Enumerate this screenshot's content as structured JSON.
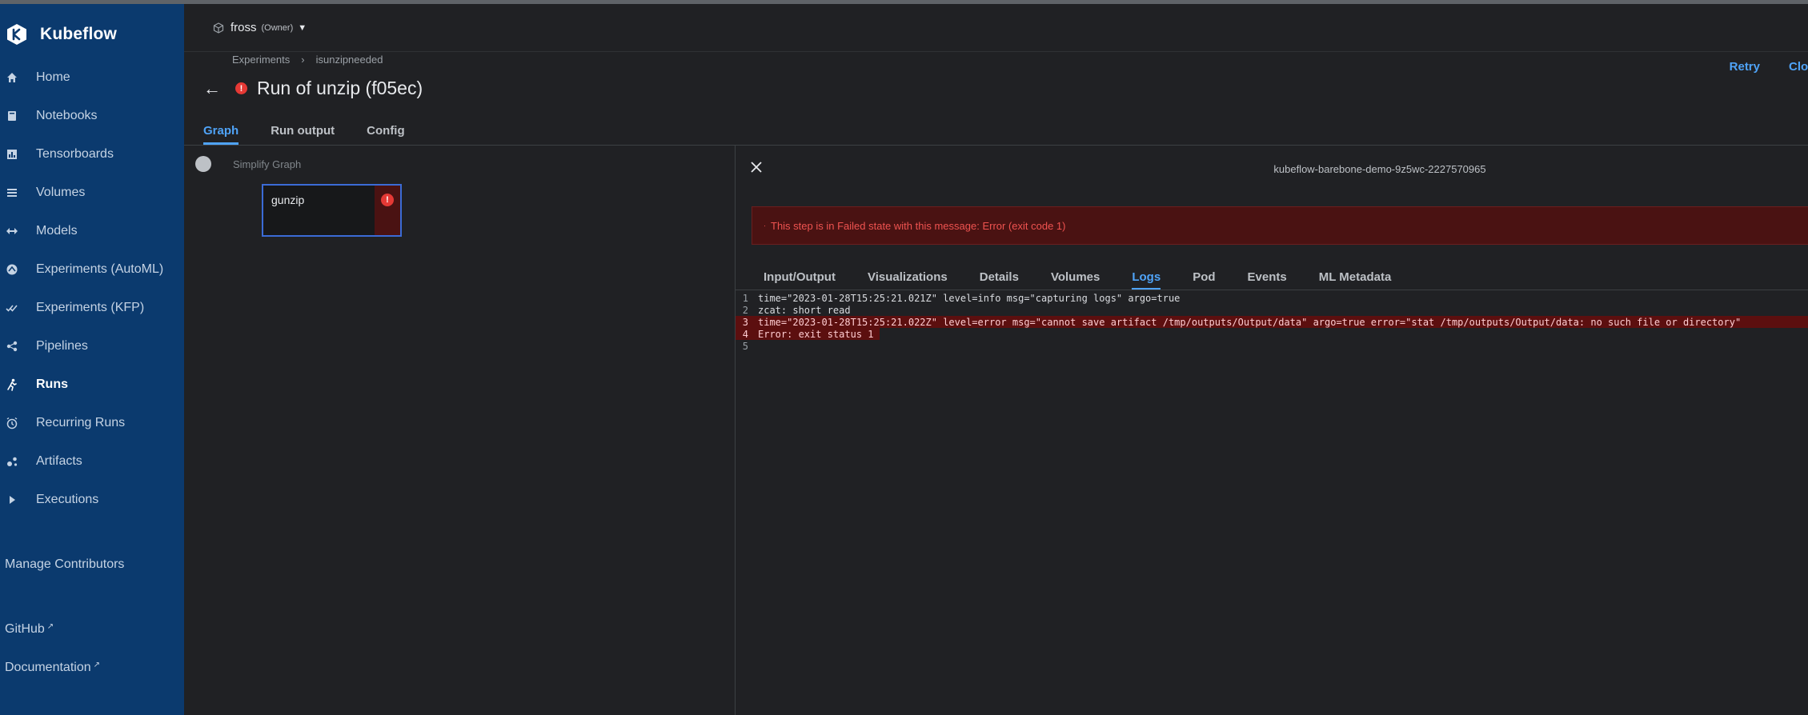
{
  "app": {
    "name": "Kubeflow"
  },
  "sidebar": {
    "items": [
      {
        "label": "Home",
        "icon": "home-icon"
      },
      {
        "label": "Notebooks",
        "icon": "notebook-icon"
      },
      {
        "label": "Tensorboards",
        "icon": "chart-icon"
      },
      {
        "label": "Volumes",
        "icon": "volumes-icon"
      },
      {
        "label": "Models",
        "icon": "arrows-horizontal-icon"
      },
      {
        "label": "Experiments (AutoML)",
        "icon": "automl-icon"
      },
      {
        "label": "Experiments (KFP)",
        "icon": "check-multiple-icon"
      },
      {
        "label": "Pipelines",
        "icon": "pipelines-icon"
      },
      {
        "label": "Runs",
        "icon": "run-icon"
      },
      {
        "label": "Recurring Runs",
        "icon": "alarm-icon"
      },
      {
        "label": "Artifacts",
        "icon": "artifacts-icon"
      },
      {
        "label": "Executions",
        "icon": "play-icon"
      }
    ],
    "active": "Runs",
    "manage_contributors": "Manage Contributors",
    "github": "GitHub",
    "documentation": "Documentation"
  },
  "namespace": {
    "name": "fross",
    "role": "(Owner)"
  },
  "breadcrumb": {
    "experiments": "Experiments",
    "experiment_name": "isunzipneeded"
  },
  "page": {
    "title": "Run of unzip (f05ec)"
  },
  "actions": {
    "retry": "Retry",
    "clone": "Clone run"
  },
  "tabs": [
    "Graph",
    "Run output",
    "Config"
  ],
  "graph": {
    "simplify_label": "Simplify Graph",
    "node_name": "gunzip"
  },
  "panel": {
    "pod_name": "kubeflow-barebone-demo-9z5wc-2227570965",
    "error_message": "This step is in Failed state with this message: Error (exit code 1)",
    "tabs": [
      "Input/Output",
      "Visualizations",
      "Details",
      "Volumes",
      "Logs",
      "Pod",
      "Events",
      "ML Metadata"
    ],
    "active_tab": "Logs",
    "logs": [
      {
        "num": "1",
        "text": "time=\"2023-01-28T15:25:21.021Z\" level=info msg=\"capturing logs\" argo=true",
        "error": false
      },
      {
        "num": "2",
        "text": "zcat: short read",
        "error": false
      },
      {
        "num": "3",
        "text": "time=\"2023-01-28T15:25:21.022Z\" level=error msg=\"cannot save artifact /tmp/outputs/Output/data\" argo=true error=\"stat /tmp/outputs/Output/data: no such file or directory\"",
        "error": true
      },
      {
        "num": "4",
        "text": "Error: exit status 1",
        "error": true
      },
      {
        "num": "5",
        "text": "",
        "error": false
      }
    ]
  },
  "colors": {
    "sidebar": "#0b3a6e",
    "accent": "#4fa3f7",
    "error": "#e53935",
    "error_bg": "#4a1212"
  }
}
